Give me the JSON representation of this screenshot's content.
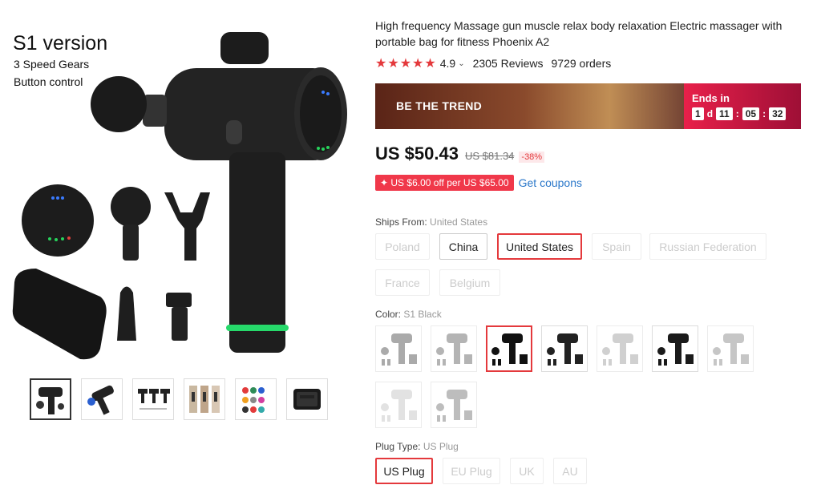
{
  "product_image": {
    "version": "S1 version",
    "speed": "3 Speed Gears",
    "control": "Button control"
  },
  "thumbnails": [
    "thumb-1",
    "thumb-2",
    "thumb-3",
    "thumb-4",
    "thumb-5",
    "thumb-6"
  ],
  "title": "High frequency Massage gun muscle relax body relaxation Electric massager with portable bag for fitness Phoenix A2",
  "rating": {
    "score": "4.9",
    "reviews": "2305 Reviews",
    "orders": "9729 orders",
    "stars": 5
  },
  "banner": {
    "text": "BE THE TREND",
    "ends_label": "Ends in",
    "days": "1",
    "day_unit": "d",
    "hours": "11",
    "minutes": "05",
    "seconds": "32",
    "sep": ":"
  },
  "price": {
    "current": "US $50.43",
    "original": "US $81.34",
    "discount": "-38%"
  },
  "coupon": {
    "tag": "✦ US $6.00 off per US $65.00",
    "link": "Get coupons"
  },
  "ships_from": {
    "label": "Ships From:",
    "value": "United States",
    "options": [
      {
        "name": "Poland",
        "state": "disabled"
      },
      {
        "name": "China",
        "state": "enabled"
      },
      {
        "name": "United States",
        "state": "selected"
      },
      {
        "name": "Spain",
        "state": "disabled"
      },
      {
        "name": "Russian Federation",
        "state": "disabled"
      },
      {
        "name": "France",
        "state": "disabled"
      },
      {
        "name": "Belgium",
        "state": "disabled"
      }
    ]
  },
  "color": {
    "label": "Color:",
    "value": "S1 Black",
    "swatch_count": 9,
    "selected_index": 2
  },
  "plug": {
    "label": "Plug Type:",
    "value": "US Plug",
    "options": [
      {
        "name": "US Plug",
        "state": "selected"
      },
      {
        "name": "EU Plug",
        "state": "disabled"
      },
      {
        "name": "UK",
        "state": "disabled"
      },
      {
        "name": "AU",
        "state": "disabled"
      }
    ]
  },
  "colors": {
    "accent": "#e4393c",
    "link": "#2a77c9",
    "banner_end": "#e8204a"
  }
}
